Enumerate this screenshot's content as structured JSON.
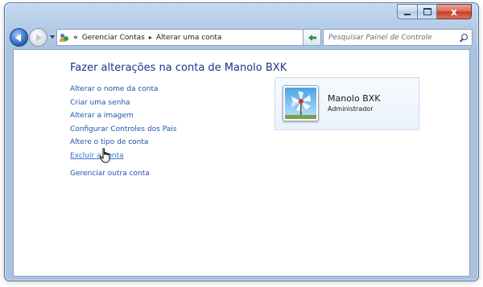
{
  "navigation": {
    "breadcrumb_chevrons": "«",
    "breadcrumbs": [
      "Gerenciar Contas",
      "Alterar uma conta"
    ],
    "breadcrumb_separator": "▸"
  },
  "search": {
    "placeholder": "Pesquisar Painel de Controle"
  },
  "window_controls": {
    "close_glyph": "x"
  },
  "main": {
    "heading": "Fazer alterações na conta de Manolo BXK",
    "tasks": [
      {
        "label": "Alterar o nome da conta"
      },
      {
        "label": "Criar uma senha"
      },
      {
        "label": "Alterar a imagem"
      },
      {
        "label": "Configurar Controles dos Pais"
      },
      {
        "label": "Altere o tipo de conta"
      },
      {
        "label": "Excluir a conta"
      },
      {
        "label": "Gerenciar outra conta"
      }
    ]
  },
  "account": {
    "name": "Manolo BXK",
    "role": "Administrador",
    "picture_icon": "flower-pinwheel-icon"
  },
  "colors": {
    "heading": "#1e3287",
    "link": "#1f55a8",
    "link_hover": "#3a76c7",
    "window_frame": "#b4cbe6",
    "close_button": "#c5391f"
  }
}
